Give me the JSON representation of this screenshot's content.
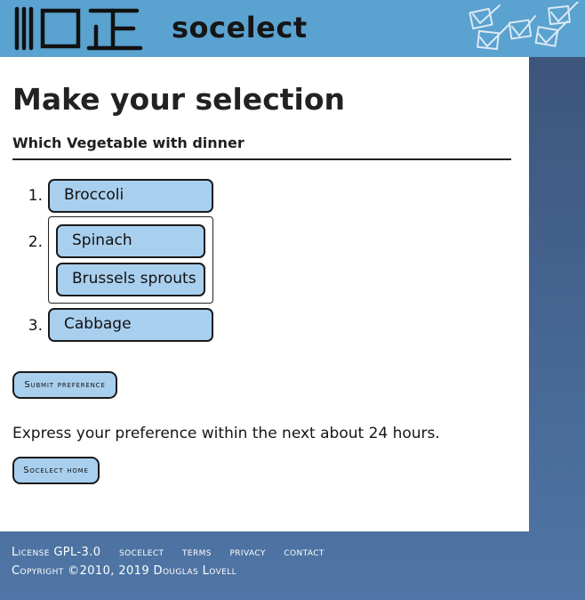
{
  "header": {
    "site_title": "socelect"
  },
  "main": {
    "page_title": "Make your selection",
    "question": "Which Vegetable with dinner",
    "ranks": [
      {
        "number": "1.",
        "options": [
          "Broccoli"
        ]
      },
      {
        "number": "2.",
        "options": [
          "Spinach",
          "Brussels sprouts"
        ]
      },
      {
        "number": "3.",
        "options": [
          "Cabbage"
        ]
      }
    ],
    "submit_label": "Submit preference",
    "notice": "Express your preference within the next about 24 hours.",
    "home_label": "Socelect home"
  },
  "footer": {
    "license": "License GPL-3.0",
    "links": [
      "socelect",
      "terms",
      "privacy",
      "contact"
    ],
    "copyright": "Copyright ©2010, 2019 Douglas Lovell"
  },
  "colors": {
    "header_bg": "#5aa2cf",
    "choice_bg": "#a9cfee",
    "page_bg": "#44628e"
  }
}
